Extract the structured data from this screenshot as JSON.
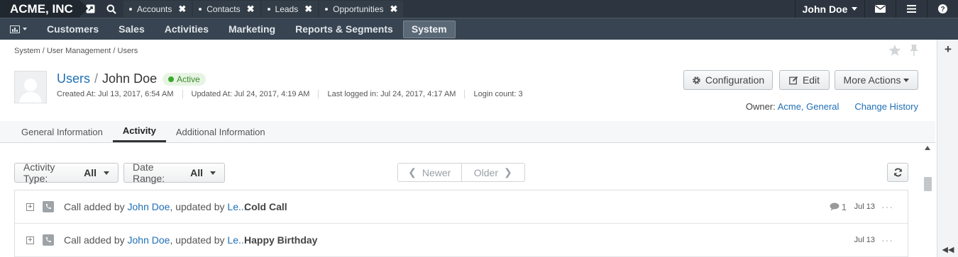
{
  "topbar": {
    "brand": "ACME, INC",
    "pinned_tabs": [
      {
        "label": "Accounts"
      },
      {
        "label": "Contacts"
      },
      {
        "label": "Leads"
      },
      {
        "label": "Opportunities"
      }
    ],
    "user": "John Doe",
    "icons": [
      "expand-icon",
      "search-icon",
      "envelope-icon",
      "hamburger-icon",
      "help-icon"
    ]
  },
  "mainmenu": {
    "items": [
      "Customers",
      "Sales",
      "Activities",
      "Marketing",
      "Reports & Segments",
      "System"
    ],
    "active": "System"
  },
  "breadcrumb": "System / User Management / Users",
  "header": {
    "entity_link": "Users",
    "separator": "/",
    "name": "John Doe",
    "status": "Active",
    "meta": [
      "Created At: Jul 13, 2017, 6:54 AM",
      "Updated At: Jul 24, 2017, 4:19 AM",
      "Last logged in: Jul 24, 2017, 4:17 AM",
      "Login count: 3"
    ],
    "buttons": {
      "configuration": "Configuration",
      "edit": "Edit",
      "more_actions": "More Actions"
    },
    "owner_label": "Owner:",
    "owner_value": "Acme, General",
    "change_history": "Change History"
  },
  "tabs": {
    "items": [
      "General Information",
      "Activity",
      "Additional Information"
    ],
    "active": "Activity"
  },
  "activity": {
    "filters": {
      "type_label": "Activity Type:",
      "type_value": "All",
      "range_label": "Date Range:",
      "range_value": "All"
    },
    "pager": {
      "newer": "Newer",
      "older": "Older"
    },
    "rows": [
      {
        "prefix": "Call added by",
        "by": "John Doe",
        "mid": ", updated by",
        "updater": "Le...",
        "subject": "Cold Call",
        "comments": "1",
        "date": "Jul 13"
      },
      {
        "prefix": "Call added by",
        "by": "John Doe",
        "mid": ", updated by",
        "updater": "Le...",
        "subject": "Happy Birthday",
        "comments": "",
        "date": "Jul 13"
      }
    ]
  },
  "colors": {
    "topbar": "#2d3640",
    "mainmenu": "#384451",
    "link": "#1f6fb4",
    "active_badge": "#3aa92d"
  }
}
